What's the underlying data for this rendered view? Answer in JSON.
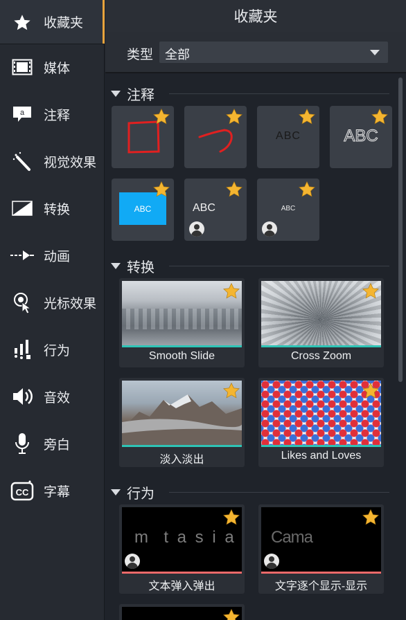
{
  "sidebar": {
    "items": [
      {
        "label": "收藏夹",
        "icon": "star-icon"
      },
      {
        "label": "媒体",
        "icon": "film-icon"
      },
      {
        "label": "注释",
        "icon": "annotation-icon"
      },
      {
        "label": "视觉效果",
        "icon": "magic-wand-icon"
      },
      {
        "label": "转换",
        "icon": "transition-icon"
      },
      {
        "label": "动画",
        "icon": "animation-arrow-icon"
      },
      {
        "label": "光标效果",
        "icon": "cursor-effect-icon"
      },
      {
        "label": "行为",
        "icon": "behavior-icon"
      },
      {
        "label": "音效",
        "icon": "audio-icon"
      },
      {
        "label": "旁白",
        "icon": "microphone-icon"
      },
      {
        "label": "字幕",
        "icon": "captions-icon"
      }
    ]
  },
  "panel": {
    "title": "收藏夹",
    "filter_label": "类型",
    "filter_value": "全部"
  },
  "sections": {
    "annotations": {
      "title": "注释",
      "tiles": [
        {
          "kind": "red-square",
          "text": ""
        },
        {
          "kind": "red-arrow",
          "text": ""
        },
        {
          "kind": "text-small",
          "text": "ABC"
        },
        {
          "kind": "text-outline",
          "text": "ABC"
        },
        {
          "kind": "blue-box",
          "text": "ABC"
        },
        {
          "kind": "text-medium",
          "text": "ABC"
        },
        {
          "kind": "text-tiny",
          "text": "ABC"
        }
      ]
    },
    "transitions": {
      "title": "转换",
      "cards": [
        {
          "caption": "Smooth Slide"
        },
        {
          "caption": "Cross Zoom"
        },
        {
          "caption": "淡入淡出"
        },
        {
          "caption": "Likes and Loves"
        }
      ]
    },
    "behaviors": {
      "title": "行为",
      "cards": [
        {
          "caption": "文本弹入弹出",
          "preview": "m  t a s i a"
        },
        {
          "caption": "文字逐个显示-显示",
          "preview": "Cama"
        }
      ]
    }
  },
  "colors": {
    "accent": "#e8a33c",
    "star": "#f4b531",
    "transition_bar": "#2ec4b6",
    "behavior_bar": "#f06a6a"
  }
}
